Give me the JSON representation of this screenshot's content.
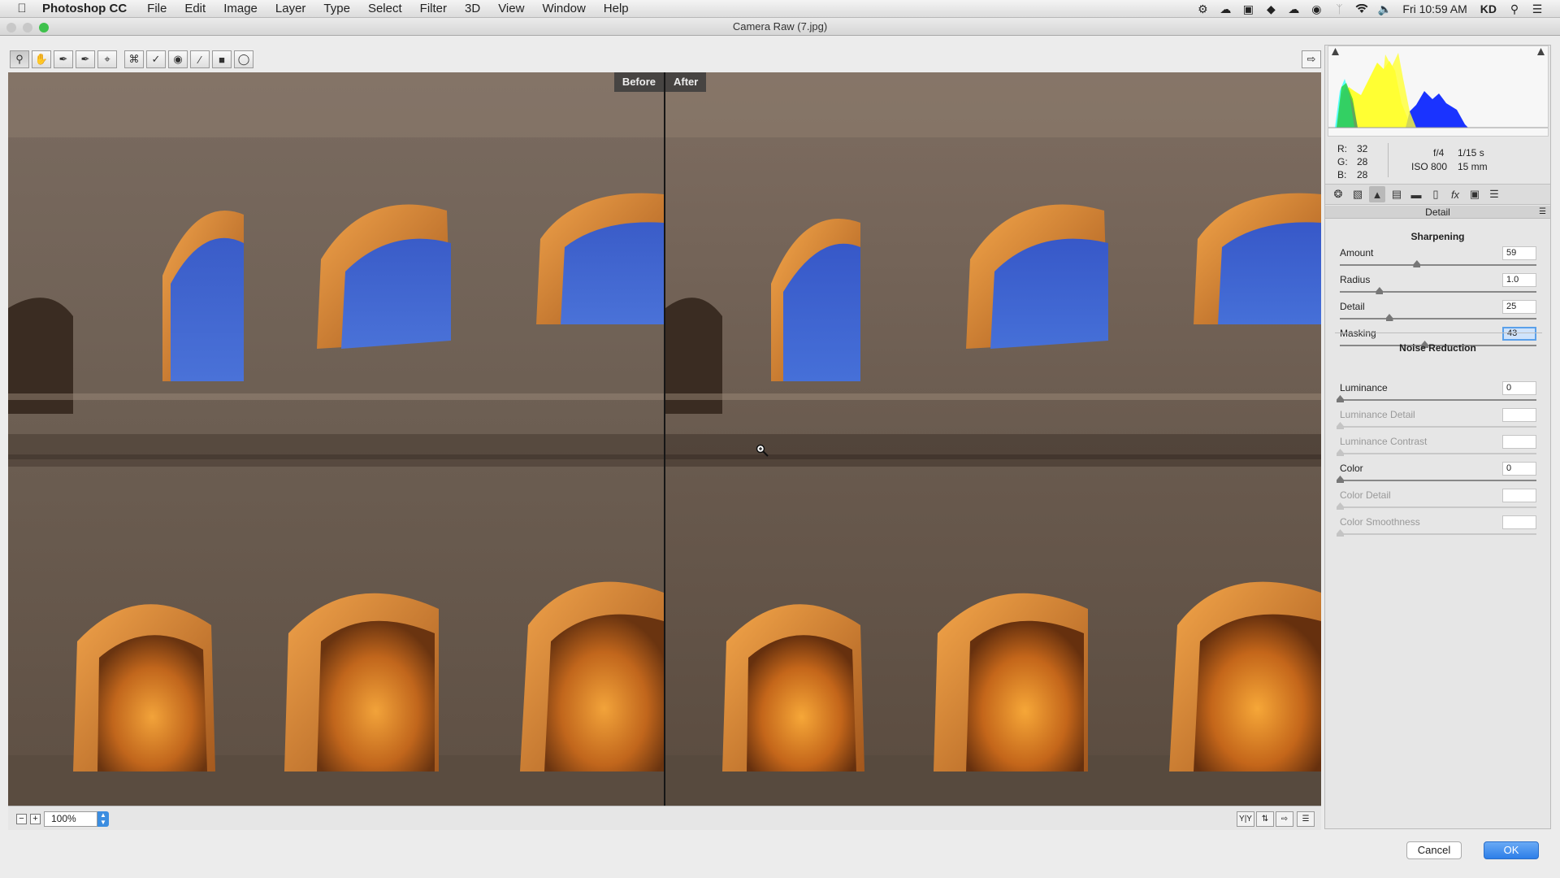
{
  "menubar": {
    "app_name": "Photoshop CC",
    "items": [
      "File",
      "Edit",
      "Image",
      "Layer",
      "Type",
      "Select",
      "Filter",
      "3D",
      "View",
      "Window",
      "Help"
    ],
    "clock": "Fri 10:59 AM",
    "user": "KD"
  },
  "window": {
    "title": "Camera Raw (7.jpg)"
  },
  "preview": {
    "before_label": "Before",
    "after_label": "After"
  },
  "zoom": {
    "value": "100%"
  },
  "camera": {
    "r_label": "R:",
    "r": "32",
    "g_label": "G:",
    "g": "28",
    "b_label": "B:",
    "b": "28",
    "aperture": "f/4",
    "shutter": "1/15 s",
    "iso": "ISO 800",
    "focal": "15 mm"
  },
  "panel": {
    "title": "Detail",
    "sharpening": {
      "title": "Sharpening",
      "sliders": [
        {
          "label": "Amount",
          "value": "59",
          "position": 0.39
        },
        {
          "label": "Radius",
          "value": "1.0",
          "position": 0.2
        },
        {
          "label": "Detail",
          "value": "25",
          "position": 0.25
        },
        {
          "label": "Masking",
          "value": "43",
          "position": 0.43
        }
      ]
    },
    "noise": {
      "title": "Noise Reduction",
      "sliders": [
        {
          "label": "Luminance",
          "value": "0",
          "position": 0,
          "disabled": false
        },
        {
          "label": "Luminance Detail",
          "value": "",
          "position": 0,
          "disabled": true
        },
        {
          "label": "Luminance Contrast",
          "value": "",
          "position": 0,
          "disabled": true
        },
        {
          "label": "Color",
          "value": "0",
          "position": 0,
          "disabled": false
        },
        {
          "label": "Color Detail",
          "value": "",
          "position": 0,
          "disabled": true
        },
        {
          "label": "Color Smoothness",
          "value": "",
          "position": 0,
          "disabled": true
        }
      ]
    }
  },
  "buttons": {
    "cancel": "Cancel",
    "ok": "OK"
  }
}
